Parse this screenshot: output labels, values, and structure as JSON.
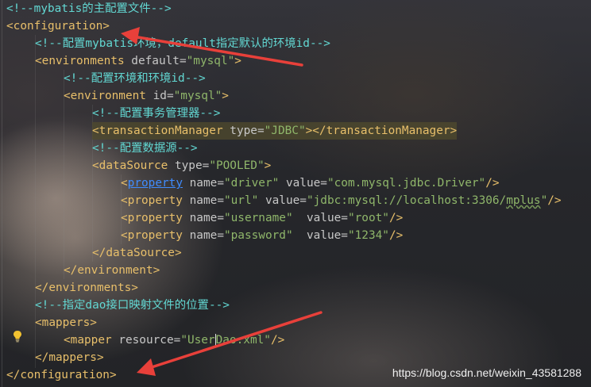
{
  "code": {
    "l1": "<!--mybatis的主配置文件-->",
    "l2": "<configuration>",
    "l3": "<!--配置mybatis环境，default指定默认的环境id-->",
    "l4": {
      "open": "<environments",
      "attr": " default",
      "eq": "=",
      "val": "\"mysql\"",
      "close": ">"
    },
    "l5": "<!--配置环境和环境id-->",
    "l6": {
      "open": "<environment",
      "attr": " id",
      "eq": "=",
      "val": "\"mysql\"",
      "close": ">"
    },
    "l7": "<!--配置事务管理器-->",
    "l8": {
      "open": "<transactionManager",
      "attr": " type",
      "eq": "=",
      "val": "\"JDBC\"",
      "close": "></transactionManager>"
    },
    "l9": "<!--配置数据源-->",
    "l10": {
      "open": "<dataSource",
      "attr": " type",
      "eq": "=",
      "val": "\"POOLED\"",
      "close": ">"
    },
    "l11": {
      "lt": "<",
      "tag": "property",
      "a1": " name",
      "v1": "\"driver\"",
      "a2": " value",
      "v2": "\"com.mysql.jdbc.Driver\"",
      "close": "/>"
    },
    "l12": {
      "open": "<property",
      "a1": " name",
      "v1": "\"url\"",
      "a2": " value",
      "v2a": "\"jdbc:mysql://localhost:3306/",
      "v2b": "mplus",
      "v2c": "\"",
      "close": "/>"
    },
    "l13": {
      "open": "<property",
      "a1": " name",
      "v1": "\"username\"",
      "a2": "  value",
      "v2": "\"root\"",
      "close": "/>"
    },
    "l14": {
      "open": "<property",
      "a1": " name",
      "v1": "\"password\"",
      "a2": "  value",
      "v2": "\"1234\"",
      "close": "/>"
    },
    "l15": "</dataSource>",
    "l16": "</environment>",
    "l17": "</environments>",
    "l18": "<!--指定dao接口映射文件的位置-->",
    "l19": "<mappers>",
    "l20": {
      "open": "<mapper",
      "attr": " resource",
      "eq": "=",
      "va": "\"User",
      "vb": "Dao.xml\"",
      "close": "/>"
    },
    "l21": "</mappers>",
    "l22": "</configuration>"
  },
  "watermark": "https://blog.csdn.net/weixin_43581288",
  "colors": {
    "comment": "#62d7d2",
    "tag": "#e8bf6a",
    "attr": "#c7c7c7",
    "value": "#8fb66a",
    "arrow": "#e8403a",
    "highlight": "#504b2d"
  },
  "icons": [
    "lightbulb-icon",
    "annotation-arrow"
  ]
}
